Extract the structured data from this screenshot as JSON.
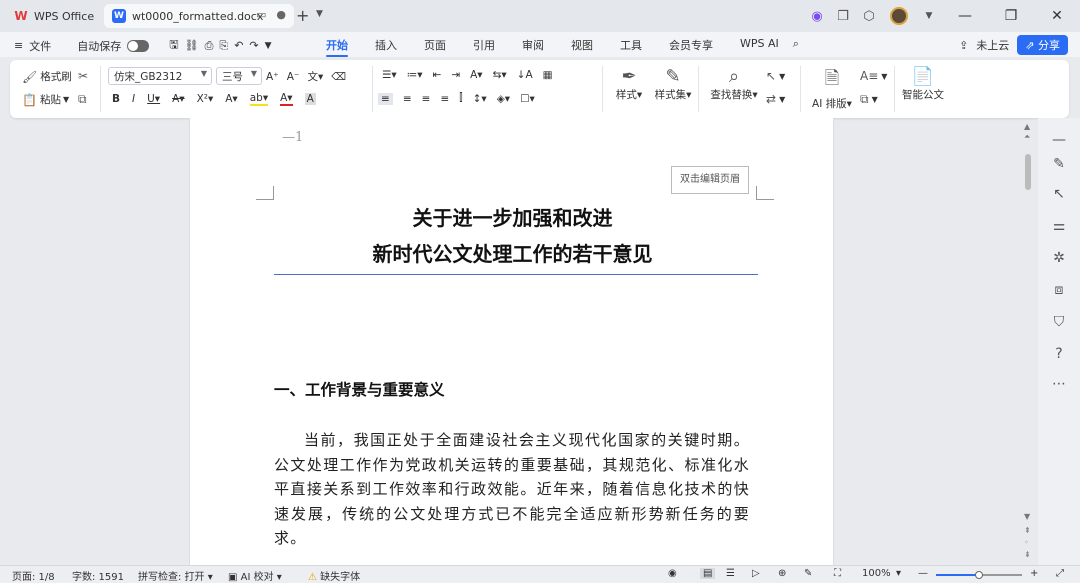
{
  "titlebar": {
    "app_tab": "WPS Office",
    "doc_tab": "wt0000_formatted.docx"
  },
  "menubar": {
    "file": "文件",
    "autosave": "自动保存",
    "tabs": [
      "开始",
      "插入",
      "页面",
      "引用",
      "审阅",
      "视图",
      "工具",
      "会员专享",
      "WPS AI"
    ],
    "active_tab": "开始",
    "cloud": "未上云",
    "share": "分享"
  },
  "ribbon": {
    "format_painter": "格式刷",
    "paste": "粘贴",
    "font_name": "仿宋_GB2312",
    "font_size": "三号",
    "styles": "样式",
    "style_set": "样式集",
    "find_replace": "查找替换",
    "ai_layout": "AI 排版",
    "smart_doc": "智能公文"
  },
  "document": {
    "page_number_mark": "—1",
    "header_hint": "双击编辑页眉",
    "title_line1": "关于进一步加强和改进",
    "title_line2": "新时代公文处理工作的若干意见",
    "heading1": "一、工作背景与重要意义",
    "paragraph1": "当前，我国正处于全面建设社会主义现代化国家的关键时期。公文处理工作作为党政机关运转的重要基础，其规范化、标准化水平直接关系到工作效率和行政效能。近年来，随着信息化技术的快速发展，传统的公文处理方式已不能完全适应新形势新任务的要求。"
  },
  "status": {
    "page": "页面: 1/8",
    "words": "字数: 1591",
    "spellcheck": "拼写检查: 打开",
    "ai_proof": "AI 校对",
    "missing_font": "缺失字体",
    "zoom": "100%",
    "zoom_fraction": 0.5
  },
  "colors": {
    "accent": "#2a6df4",
    "wps_red": "#e03a3a"
  }
}
